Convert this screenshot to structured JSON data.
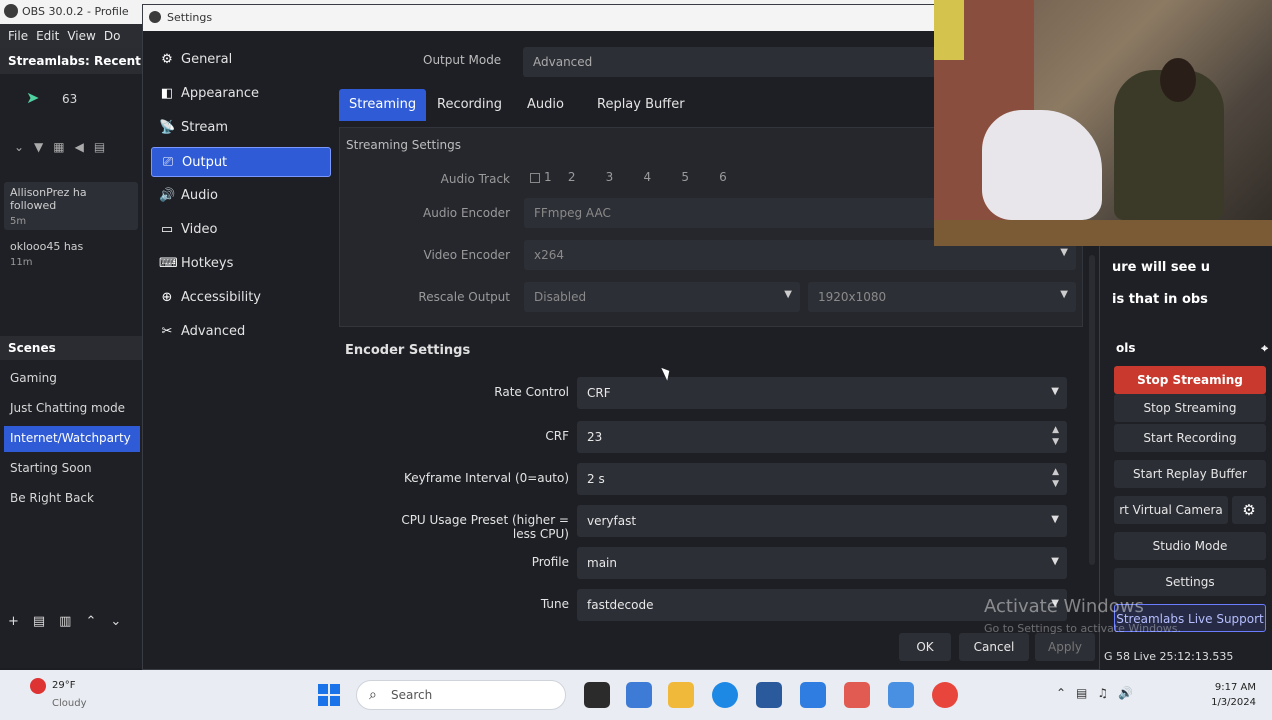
{
  "obs": {
    "window_title": "OBS 30.0.2 - Profile",
    "menu": [
      "File",
      "Edit",
      "View",
      "Do"
    ],
    "chat_dock_title": "Streamlabs: Recent",
    "chat_count": "63",
    "chat_messages": [
      {
        "text": "AllisonPrez ha followed",
        "meta": "5m"
      },
      {
        "text": "oklooo45 has",
        "meta": "11m"
      }
    ],
    "scenes_title": "Scenes",
    "scenes": [
      "Gaming",
      "Just Chatting mode",
      "Internet/Watchparty",
      "Starting Soon",
      "Be Right Back"
    ],
    "active_scene": "Internet/Watchparty",
    "caption_lines": [
      "ure will see u",
      "is that in obs"
    ],
    "controls_title": "ols",
    "controls": {
      "stop_streaming": "Stop Streaming",
      "start_streaming_2": "Stop Streaming",
      "start_recording": "Start Recording",
      "start_replay": "Start Replay Buffer",
      "virtual_camera": "rt Virtual Camera",
      "studio_mode": "Studio Mode",
      "settings": "Settings",
      "support": "Streamlabs Live Support"
    },
    "status_text": "G  58 Live 25:12:13.535"
  },
  "dialog": {
    "title": "Settings",
    "nav": [
      {
        "label": "General",
        "icon": "gear-icon",
        "glyph": "⚙"
      },
      {
        "label": "Appearance",
        "icon": "appearance-icon",
        "glyph": "◧"
      },
      {
        "label": "Stream",
        "icon": "stream-icon",
        "glyph": "📡"
      },
      {
        "label": "Output",
        "icon": "output-icon",
        "glyph": "⎚"
      },
      {
        "label": "Audio",
        "icon": "speaker-icon",
        "glyph": "🔊"
      },
      {
        "label": "Video",
        "icon": "monitor-icon",
        "glyph": "▭"
      },
      {
        "label": "Hotkeys",
        "icon": "keyboard-icon",
        "glyph": "⌨"
      },
      {
        "label": "Accessibility",
        "icon": "accessibility-icon",
        "glyph": "⊕"
      },
      {
        "label": "Advanced",
        "icon": "tools-icon",
        "glyph": "✂"
      }
    ],
    "active_nav": "Output",
    "output_mode_label": "Output Mode",
    "output_mode_value": "Advanced",
    "tabs": [
      "Streaming",
      "Recording",
      "Audio",
      "Replay Buffer"
    ],
    "active_tab": "Streaming",
    "streaming_settings_title": "Streaming Settings",
    "audio_track_label": "Audio Track",
    "audio_tracks": [
      "1",
      "2",
      "3",
      "4",
      "5",
      "6"
    ],
    "audio_encoder_label": "Audio Encoder",
    "audio_encoder_value": "FFmpeg AAC",
    "video_encoder_label": "Video Encoder",
    "video_encoder_value": "x264",
    "rescale_label": "Rescale Output",
    "rescale_value": "Disabled",
    "rescale_res": "1920x1080",
    "encoder_settings_title": "Encoder Settings",
    "encoder_rows": [
      {
        "label": "Rate Control",
        "value": "CRF",
        "kind": "dropdown"
      },
      {
        "label": "CRF",
        "value": "23",
        "kind": "spin"
      },
      {
        "label": "Keyframe Interval (0=auto)",
        "value": "2 s",
        "kind": "spin"
      },
      {
        "label": "CPU Usage Preset (higher = less CPU)",
        "value": "veryfast",
        "kind": "dropdown"
      },
      {
        "label": "Profile",
        "value": "main",
        "kind": "dropdown"
      },
      {
        "label": "Tune",
        "value": "fastdecode",
        "kind": "dropdown"
      }
    ],
    "buttons": {
      "ok": "OK",
      "cancel": "Cancel",
      "apply": "Apply"
    },
    "watermark_title": "Activate Windows",
    "watermark_sub": "Go to Settings to activate Windows."
  },
  "taskbar": {
    "weather_temp": "29°F",
    "weather_desc": "Cloudy",
    "search_placeholder": "Search",
    "time": "9:17 AM",
    "date": "1/3/2024"
  }
}
